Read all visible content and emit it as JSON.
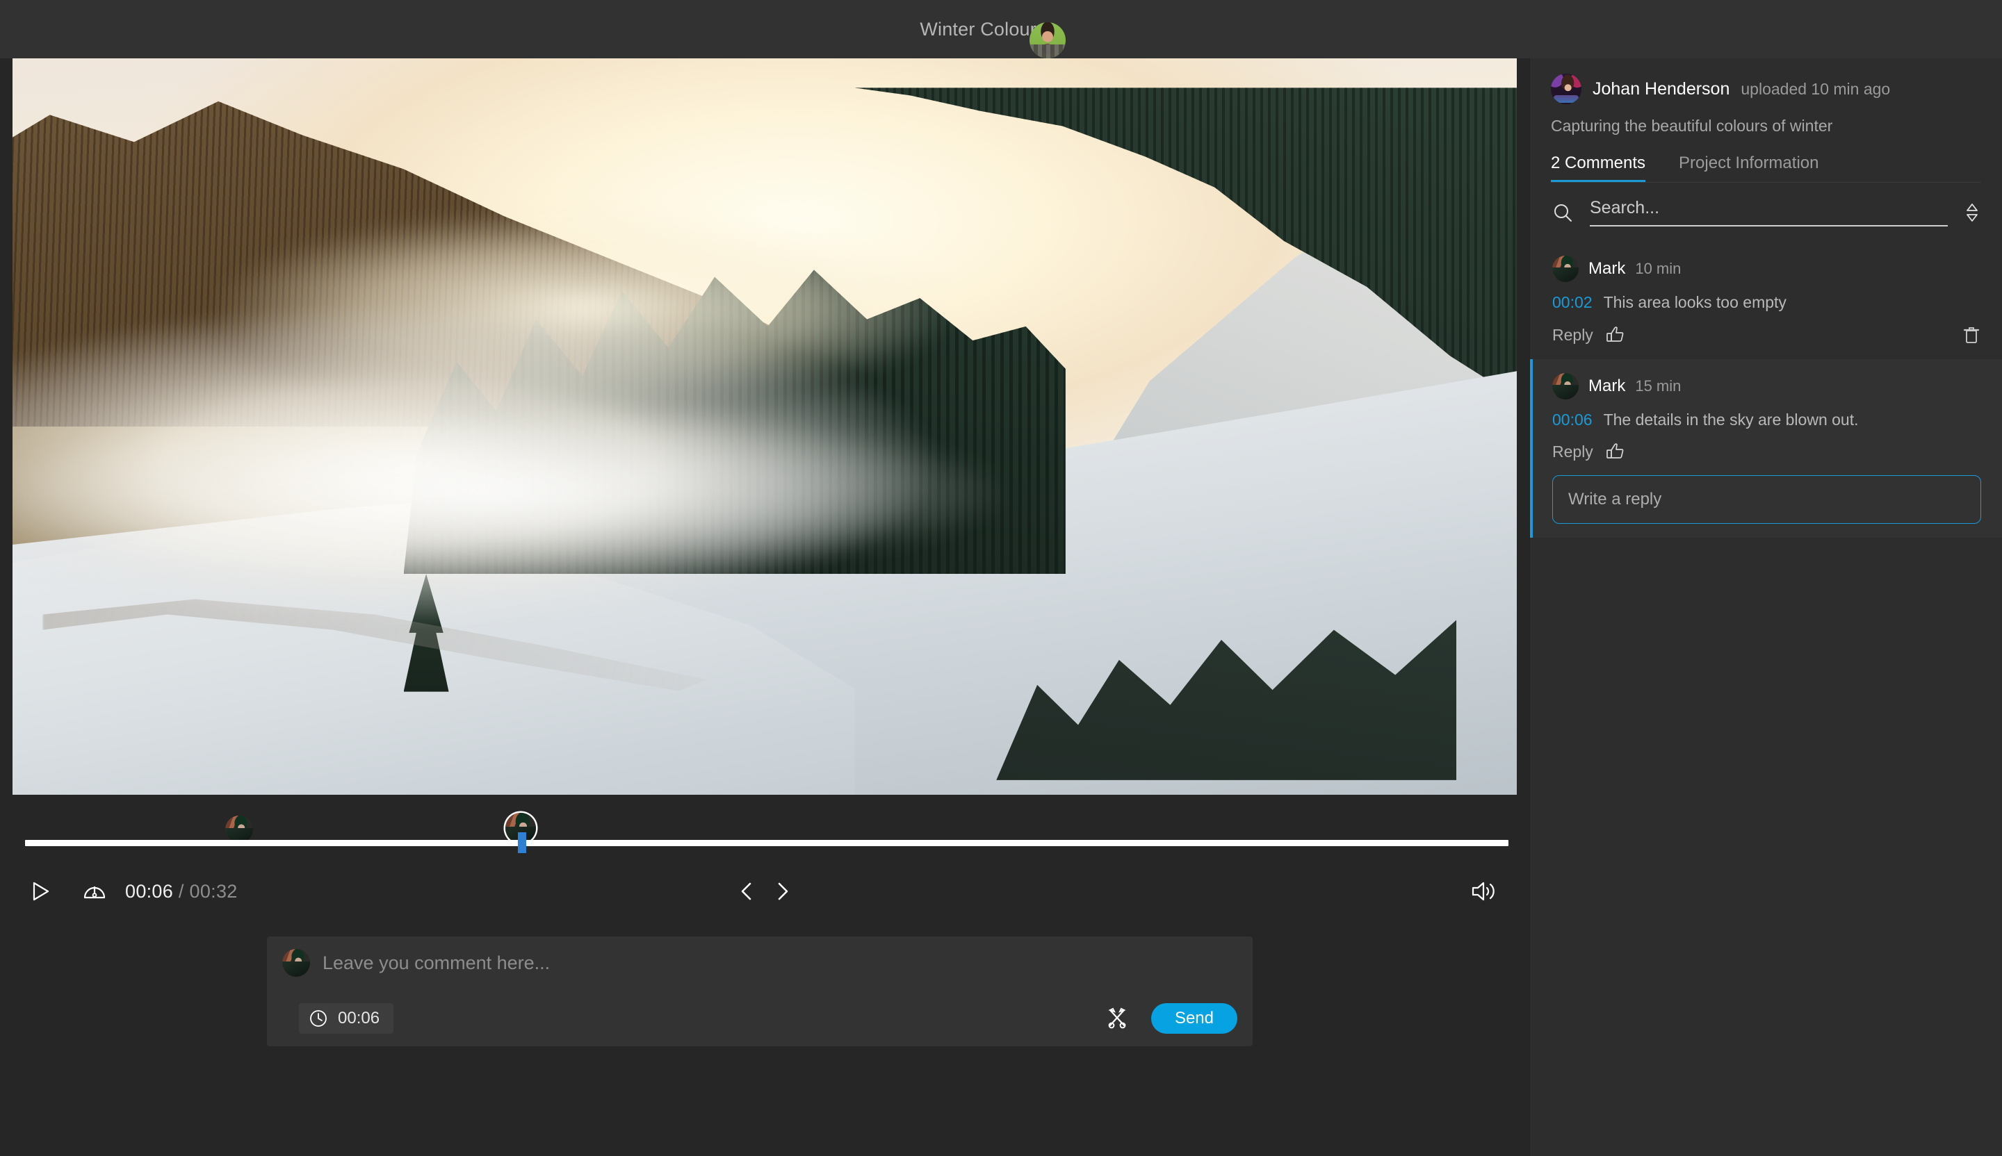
{
  "topbar": {
    "title": "Winter Colours",
    "avatar_name": "current-user-avatar"
  },
  "player": {
    "current_time": "00:06",
    "duration": "00:32",
    "separator": "/",
    "play_label": "play-icon",
    "speed_label": "playback-speed-icon",
    "prev_frame_label": "previous-frame-icon",
    "next_frame_label": "next-frame-icon",
    "volume_label": "volume-icon",
    "playhead_percent": 18.4,
    "markers": [
      {
        "percent": 14.5,
        "active": false,
        "label": "Mark"
      },
      {
        "percent": 18.4,
        "active": true,
        "label": "Mark"
      }
    ]
  },
  "composer": {
    "placeholder": "Leave you comment here...",
    "timestamp": "00:06",
    "draw_label": "annotate-icon",
    "send_label": "Send",
    "accent": "#06a2e2"
  },
  "sidebar": {
    "uploader": {
      "name": "Johan Henderson",
      "meta": "uploaded 10 min ago"
    },
    "description": "Capturing the beautiful colours of winter",
    "tabs": [
      {
        "label": "2 Comments",
        "active": true
      },
      {
        "label": "Project Information",
        "active": false
      }
    ],
    "search": {
      "placeholder": "Search...",
      "sort_label": "sort-icon"
    },
    "comments": [
      {
        "author": "Mark",
        "time": "10 min",
        "stamp": "00:02",
        "text": "This area looks too empty",
        "reply_label": "Reply",
        "like_label": "thumbs-up-icon",
        "delete_label": "delete-icon",
        "active": false,
        "has_delete": true,
        "has_reply_box": false
      },
      {
        "author": "Mark",
        "time": "15 min",
        "stamp": "00:06",
        "text": "The details in the sky are blown out.",
        "reply_label": "Reply",
        "like_label": "thumbs-up-icon",
        "active": true,
        "has_delete": false,
        "has_reply_box": true,
        "reply_placeholder": "Write a reply"
      }
    ]
  },
  "colors": {
    "accent_blue": "#1b9ad6",
    "send_blue": "#06a2e2",
    "playhead_blue": "#2f7fd4",
    "topbar_bg": "#323232",
    "player_bg": "#262626",
    "sidebar_bg": "#2d2d2d"
  }
}
